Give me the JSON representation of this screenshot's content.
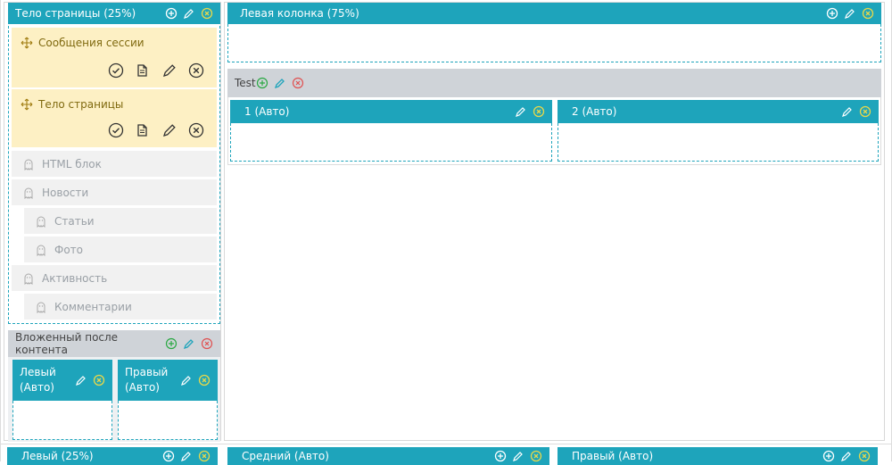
{
  "left_panel": {
    "title": "Тело страницы (25%)",
    "modules": [
      {
        "label": "Сообщения сессии"
      },
      {
        "label": "Тело страницы"
      }
    ],
    "ghost_items": [
      {
        "label": "HTML блок",
        "indent": 0
      },
      {
        "label": "Новости",
        "indent": 0
      },
      {
        "label": "Статьи",
        "indent": 1
      },
      {
        "label": "Фото",
        "indent": 1
      },
      {
        "label": "Активность",
        "indent": 0
      },
      {
        "label": "Комментарии",
        "indent": 1
      }
    ],
    "nested": {
      "title": "Вложенный после контента",
      "cols": [
        {
          "label": "Левый (Авто)"
        },
        {
          "label": "Правый (Авто)"
        }
      ]
    }
  },
  "right_panel": {
    "title": "Левая колонка (75%)",
    "test": {
      "title": "Test",
      "cols": [
        {
          "label": "1 (Авто)"
        },
        {
          "label": "2 (Авто)"
        }
      ]
    }
  },
  "bottom_row": [
    {
      "label": "Левый (25%)"
    },
    {
      "label": "Средний (Авто)"
    },
    {
      "label": "Правый (Авто)"
    }
  ],
  "colors": {
    "accent": "#1ea4bb",
    "module_bg": "#fdf0c4",
    "add": "#2aa843",
    "remove": "#e05050",
    "yellow_icon": "#e8d84a"
  }
}
